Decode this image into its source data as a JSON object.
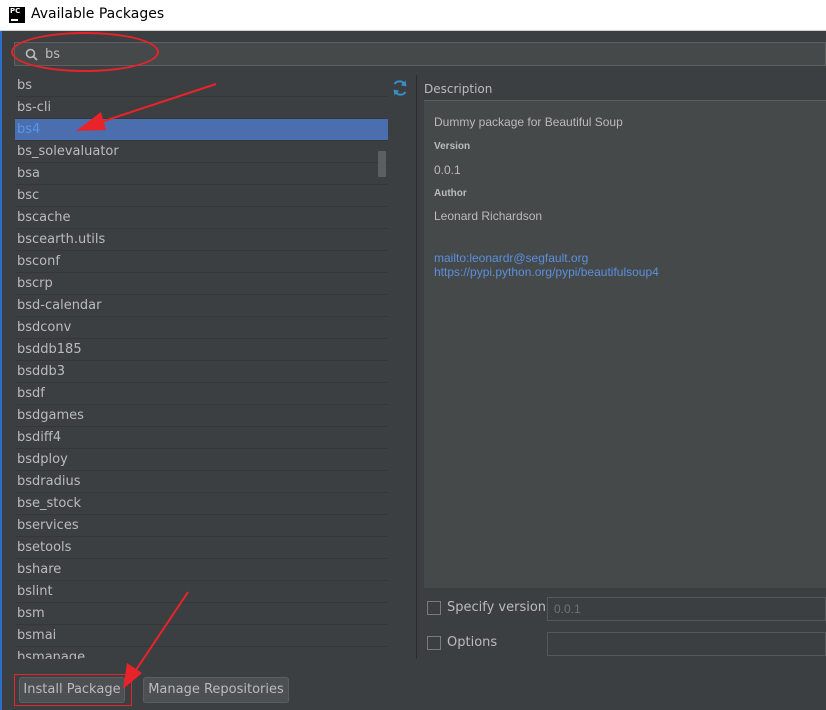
{
  "window": {
    "title": "Available Packages",
    "app_icon_text": "PC"
  },
  "search": {
    "value": "bs",
    "placeholder": ""
  },
  "packages": [
    "bs",
    "bs-cli",
    "bs4",
    "bs_solevaluator",
    "bsa",
    "bsc",
    "bscache",
    "bscearth.utils",
    "bsconf",
    "bscrp",
    "bsd-calendar",
    "bsdconv",
    "bsddb185",
    "bsddb3",
    "bsdf",
    "bsdgames",
    "bsdiff4",
    "bsdploy",
    "bsdradius",
    "bse_stock",
    "bservices",
    "bsetools",
    "bshare",
    "bslint",
    "bsm",
    "bsmai",
    "bsmanage"
  ],
  "selected_package": "bs4",
  "description": {
    "header": "Description",
    "summary": "Dummy package for Beautiful Soup",
    "version_label": "Version",
    "version": "0.0.1",
    "author_label": "Author",
    "author": "Leonard Richardson",
    "email_link": "mailto:leonardr@segfault.org",
    "homepage_link": "https://pypi.python.org/pypi/beautifulsoup4"
  },
  "options": {
    "specify_version_label": "Specify version",
    "specify_version_value": "0.0.1",
    "options_label": "Options",
    "options_value": ""
  },
  "buttons": {
    "install": "Install Package",
    "manage": "Manage Repositories"
  },
  "colors": {
    "background": "#3c3f41",
    "selection": "#4b6eaf",
    "link": "#5c8fdc",
    "annotation": "#e8232a"
  }
}
